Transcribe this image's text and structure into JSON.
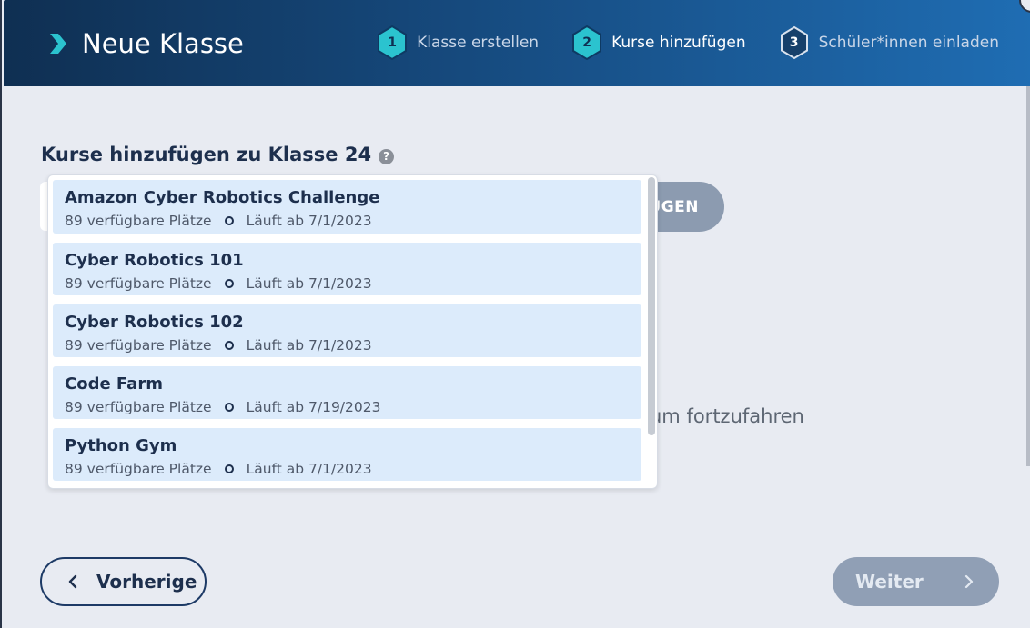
{
  "header": {
    "title": "Neue Klasse",
    "steps": [
      {
        "number": "1",
        "label": "Klasse erstellen",
        "state": "done"
      },
      {
        "number": "2",
        "label": "Kurse hinzufügen",
        "state": "active"
      },
      {
        "number": "3",
        "label": "Schüler*innen einladen",
        "state": "upcoming"
      }
    ]
  },
  "main": {
    "heading": "Kurse hinzufügen zu Klasse 24",
    "help_icon": "?",
    "add_button_partial": "ÜGEN",
    "hint_partial": "um fortzufahren"
  },
  "dropdown": {
    "items": [
      {
        "name": "Amazon Cyber Robotics Challenge",
        "seats": "89 verfügbare Plätze",
        "runs": "Läuft ab 7/1/2023"
      },
      {
        "name": "Cyber Robotics 101",
        "seats": "89 verfügbare Plätze",
        "runs": "Läuft ab 7/1/2023"
      },
      {
        "name": "Cyber Robotics 102",
        "seats": "89 verfügbare Plätze",
        "runs": "Läuft ab 7/1/2023"
      },
      {
        "name": "Code Farm",
        "seats": "89 verfügbare Plätze",
        "runs": "Läuft ab 7/19/2023"
      },
      {
        "name": "Python Gym",
        "seats": "89 verfügbare Plätze",
        "runs": "Läuft ab 7/1/2023"
      }
    ]
  },
  "footer": {
    "prev_label": "Vorherige",
    "next_label": "Weiter"
  },
  "colors": {
    "accent_teal": "#2bc3cf",
    "navy": "#1d2f4d",
    "item_bg": "#dcebfb",
    "disabled_button": "#909fb5"
  },
  "icons": {
    "logo": "chevron-right-icon",
    "prev": "chevron-left-icon",
    "next": "chevron-right-icon",
    "help": "question-icon"
  }
}
